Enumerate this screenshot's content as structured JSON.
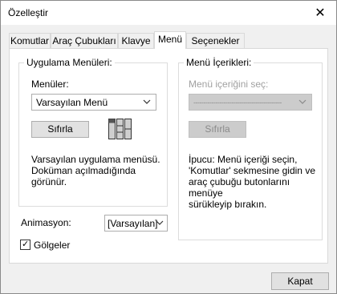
{
  "window": {
    "title": "Özelleştir",
    "close_glyph": "✕"
  },
  "tabs": [
    {
      "label": "Komutlar"
    },
    {
      "label": "Araç Çubukları"
    },
    {
      "label": "Klavye"
    },
    {
      "label": "Menü"
    },
    {
      "label": "Seçenekler"
    }
  ],
  "app_menus": {
    "group_title": "Uygulama Menüleri:",
    "menus_label": "Menüler:",
    "menus_value": "Varsayılan Menü",
    "reset_label": "Sıfırla",
    "description_line1": "Varsayılan uygulama menüsü.",
    "description_line2": "Doküman açılmadığında görünür."
  },
  "menu_contents": {
    "group_title": "Menü İçerikleri:",
    "select_label": "Menü içeriğini seç:",
    "select_value": "--------------------------------------------",
    "reset_label": "Sıfırla",
    "tip_line1": "İpucu: Menü içeriği seçin,",
    "tip_line2": "'Komutlar' sekmesine gidin ve",
    "tip_line3": "araç çubuğu butonlarını menüye",
    "tip_line4": "sürükleyip bırakın."
  },
  "animation": {
    "label": "Animasyon:",
    "value": "[Varsayılan]"
  },
  "shadows": {
    "label": "Gölgeler",
    "checked": true
  },
  "footer": {
    "close_label": "Kapat"
  }
}
